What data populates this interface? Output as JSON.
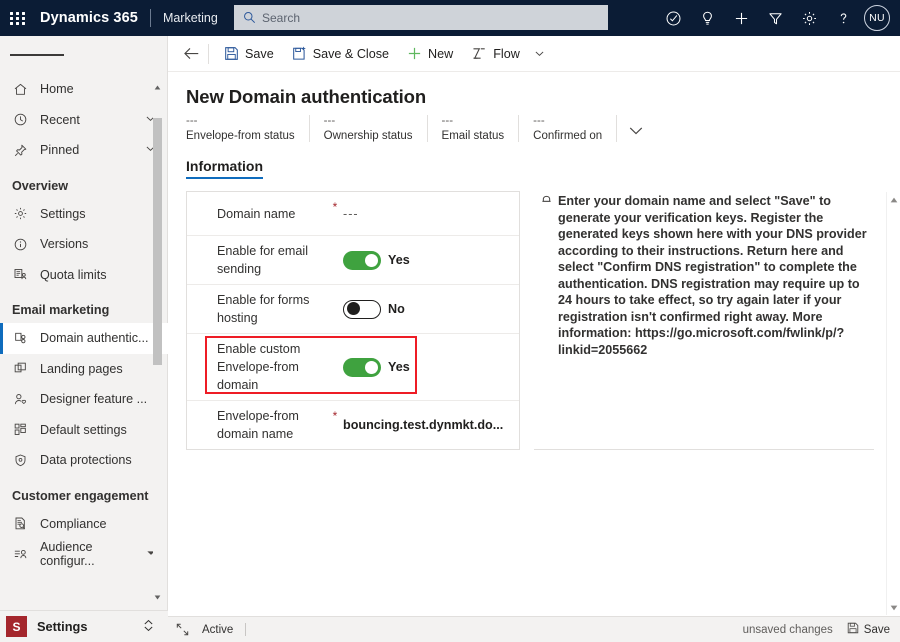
{
  "topbar": {
    "waffle_label": "app-launcher",
    "brand": "Dynamics 365",
    "app_name": "Marketing",
    "search_placeholder": "Search",
    "icons": [
      {
        "name": "trial-check-icon",
        "label": "Trial info"
      },
      {
        "name": "lightbulb-icon",
        "label": "Ideas"
      },
      {
        "name": "plus-icon",
        "label": "Quick create"
      },
      {
        "name": "filter-icon",
        "label": "Filter"
      },
      {
        "name": "gear-icon",
        "label": "Settings"
      },
      {
        "name": "question-icon",
        "label": "Help"
      }
    ],
    "avatar_initials": "NU"
  },
  "sidebar": {
    "hamburger_label": "Expand navigation",
    "items": [
      {
        "label": "Home",
        "icon": "home-icon",
        "chevron": false,
        "selected": false
      },
      {
        "label": "Recent",
        "icon": "clock-icon",
        "chevron": true,
        "selected": false
      },
      {
        "label": "Pinned",
        "icon": "pin-icon",
        "chevron": true,
        "selected": false
      }
    ],
    "groups": [
      {
        "title": "Overview",
        "items": [
          {
            "label": "Settings",
            "icon": "gear-icon",
            "selected": false
          },
          {
            "label": "Versions",
            "icon": "info-circle-icon",
            "selected": false
          },
          {
            "label": "Quota limits",
            "icon": "quota-icon",
            "selected": false
          }
        ]
      },
      {
        "title": "Email marketing",
        "items": [
          {
            "label": "Domain authentic...",
            "icon": "domain-auth-icon",
            "selected": true
          },
          {
            "label": "Landing pages",
            "icon": "pages-icon",
            "selected": false
          },
          {
            "label": "Designer feature ...",
            "icon": "person-heart-icon",
            "selected": false
          },
          {
            "label": "Default settings",
            "icon": "grid-blocks-icon",
            "selected": false
          },
          {
            "label": "Data protections",
            "icon": "shield-icon",
            "selected": false
          }
        ]
      },
      {
        "title": "Customer engagement",
        "items": [
          {
            "label": "Compliance",
            "icon": "document-search-icon",
            "selected": false
          },
          {
            "label": "Audience configur...",
            "icon": "audience-icon",
            "selected": false
          }
        ]
      }
    ],
    "footer": {
      "tile": "S",
      "label": "Settings",
      "chevron_icon": "chevron-updown-icon"
    }
  },
  "commandbar": {
    "back_icon": "back-arrow-icon",
    "buttons": [
      {
        "label": "Save",
        "icon": "save-icon"
      },
      {
        "label": "Save & Close",
        "icon": "save-close-icon"
      },
      {
        "label": "New",
        "icon": "plus-icon"
      },
      {
        "label": "Flow",
        "icon": "flow-icon"
      }
    ],
    "overflow_icon": "chevron-down-icon"
  },
  "page": {
    "title": "New Domain authentication",
    "status_cells": [
      {
        "value": "---",
        "label": "Envelope-from status"
      },
      {
        "value": "---",
        "label": "Ownership status"
      },
      {
        "value": "---",
        "label": "Email status"
      },
      {
        "value": "---",
        "label": "Confirmed on"
      }
    ],
    "expand_icon": "chevron-down-icon",
    "tabs": [
      {
        "label": "Information",
        "active": true
      }
    ]
  },
  "form": {
    "rows": [
      {
        "type": "text",
        "label": "Domain name",
        "required": "*",
        "value": "---",
        "muted": true,
        "name": "domain-name"
      },
      {
        "type": "toggle",
        "label": "Enable for email sending",
        "required": "",
        "state": "on",
        "state_text": "Yes",
        "name": "enable-for-email-sending"
      },
      {
        "type": "toggle",
        "label": "Enable for forms hosting",
        "required": "",
        "state": "off",
        "state_text": "No",
        "name": "enable-for-forms-hosting"
      },
      {
        "type": "toggle",
        "label": "Enable custom Envelope-from domain",
        "required": "",
        "state": "on",
        "state_text": "Yes",
        "name": "enable-custom-envelope-from-domain",
        "highlighted": true
      },
      {
        "type": "text",
        "label": "Envelope-from domain name",
        "required": "*",
        "value": "bouncing.test.dynmkt.do...",
        "muted": false,
        "name": "envelope-from-domain-name"
      }
    ]
  },
  "infopanel": {
    "icon": "lock-icon",
    "text": "Enter your domain name and select \"Save\" to generate your verification keys. Register the generated keys shown here with your DNS provider according to their instructions. Return here and select \"Confirm DNS registration\" to complete the authentication. DNS registration may require up to 24 hours to take effect, so try again later if your registration isn't confirmed right away. More information: https://go.microsoft.com/fwlink/p/?linkid=2055662"
  },
  "statusbar": {
    "expand_icon": "expand-icon",
    "state": "Active",
    "unsaved": "unsaved changes",
    "save_label": "Save",
    "save_icon": "save-icon"
  },
  "colors": {
    "header_bg": "#0b1c35",
    "accent": "#0f6cbd",
    "toggle_on": "#3fa23f",
    "highlight_red": "#ee1c25",
    "required_red": "#a4262c",
    "settings_tile": "#a4262c"
  }
}
